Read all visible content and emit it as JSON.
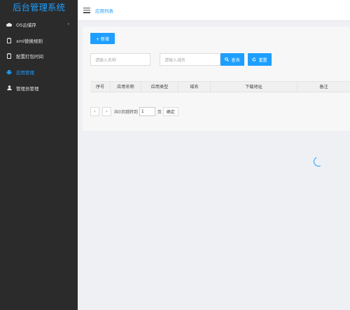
{
  "sidebar": {
    "brand": "后台管理系统",
    "items": [
      {
        "label": "OS云储存",
        "icon": "cloud-icon",
        "active": false,
        "has_arrow": true
      },
      {
        "label": "xml替换规则",
        "icon": "clipboard-icon",
        "active": false
      },
      {
        "label": "配置打包时间",
        "icon": "clipboard-icon",
        "active": false
      },
      {
        "label": "应用管理",
        "icon": "android-icon",
        "active": true
      },
      {
        "label": "管理员管理",
        "icon": "user-icon",
        "active": false
      }
    ],
    "arrow_glyph": "›"
  },
  "header": {
    "breadcrumb": "应用列表"
  },
  "toolbar": {
    "add_label": "+ 新增",
    "name_placeholder": "请输入名称",
    "domain_placeholder": "请输入域名",
    "search_label": "查询",
    "reset_label": "重置"
  },
  "table": {
    "columns": [
      "序号",
      "应用名称",
      "应用类型",
      "域名",
      "下载地址",
      "备注"
    ]
  },
  "pager": {
    "prev": "‹",
    "next": "›",
    "total_text": "共0页跳转到",
    "page_value": "1",
    "page_unit": "页",
    "go_label": "确定"
  },
  "colors": {
    "accent": "#1e9fff",
    "sidebar_bg": "#2b2b2b"
  }
}
